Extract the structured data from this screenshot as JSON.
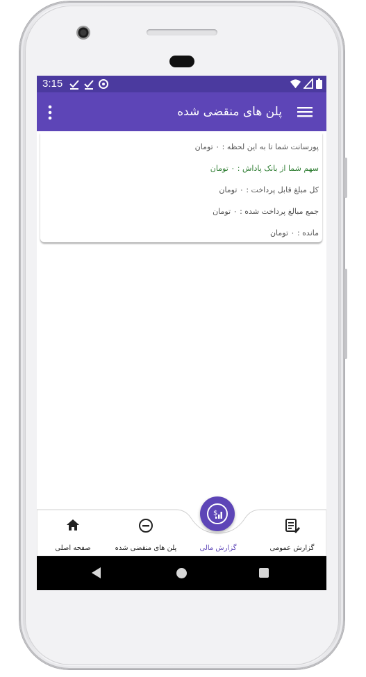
{
  "status_bar": {
    "time": "3:15"
  },
  "app_bar": {
    "title": "پلن های منقضی شده"
  },
  "summary": {
    "percentage": "پورسانت شما تا به این لحظه : ۰ تومان",
    "reward_share": "سهم شما از بانک پاداش : ۰ تومان",
    "total_payable": "کل مبلغ قابل پرداخت : ۰ تومان",
    "total_paid": "جمع مبالغ پرداخت شده : ۰ تومان",
    "remaining": "مانده : ۰ تومان"
  },
  "bottom_nav": {
    "general_report": "گزارش عمومی",
    "financial_report": "گزارش مالی",
    "expired_plans": "پلن های منقضی شده",
    "home": "صفحه اصلی"
  },
  "colors": {
    "status_bar": "#4b3a9f",
    "app_bar": "#5d45b7",
    "accent": "#5d45b7",
    "green_text": "#2e7d32"
  },
  "icons": {
    "menu": "hamburger-icon",
    "more": "more-vert-icon",
    "home": "home-icon",
    "expired": "minus-circle-icon",
    "financial": "dollar-chart-icon",
    "general": "report-edit-icon"
  }
}
